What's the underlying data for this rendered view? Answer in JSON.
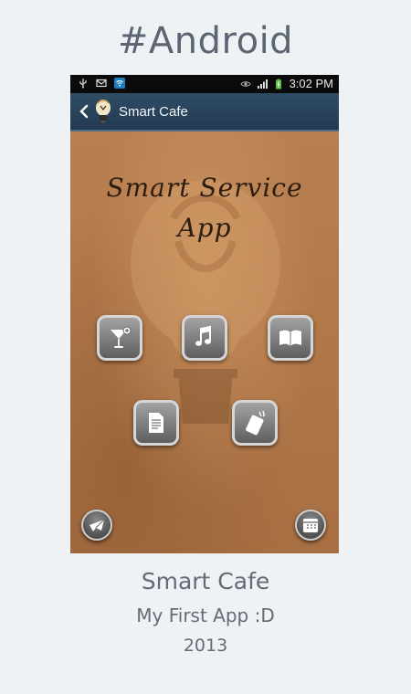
{
  "header": {
    "hashtag": "#Android"
  },
  "statusbar": {
    "time": "3:02 PM",
    "icons": [
      "usb-icon",
      "gmail-icon",
      "wifi-icon",
      "eye-icon",
      "signal-icon",
      "battery-icon"
    ]
  },
  "actionbar": {
    "title": "Smart Cafe"
  },
  "app": {
    "heading_line1": "Smart Service",
    "heading_line2": "App",
    "grid_buttons": [
      "cocktail-icon",
      "music-icon",
      "book-icon",
      "document-icon",
      "phone-icon"
    ],
    "bottom_buttons": [
      "mail-icon",
      "calendar-icon"
    ]
  },
  "footer": {
    "app_name": "Smart Cafe",
    "subtitle": "My First App :D",
    "year": "2013"
  },
  "colors": {
    "page_bg": "#eff2f5",
    "actionbar": "#2f4c66",
    "wood": "#b27a4c"
  }
}
